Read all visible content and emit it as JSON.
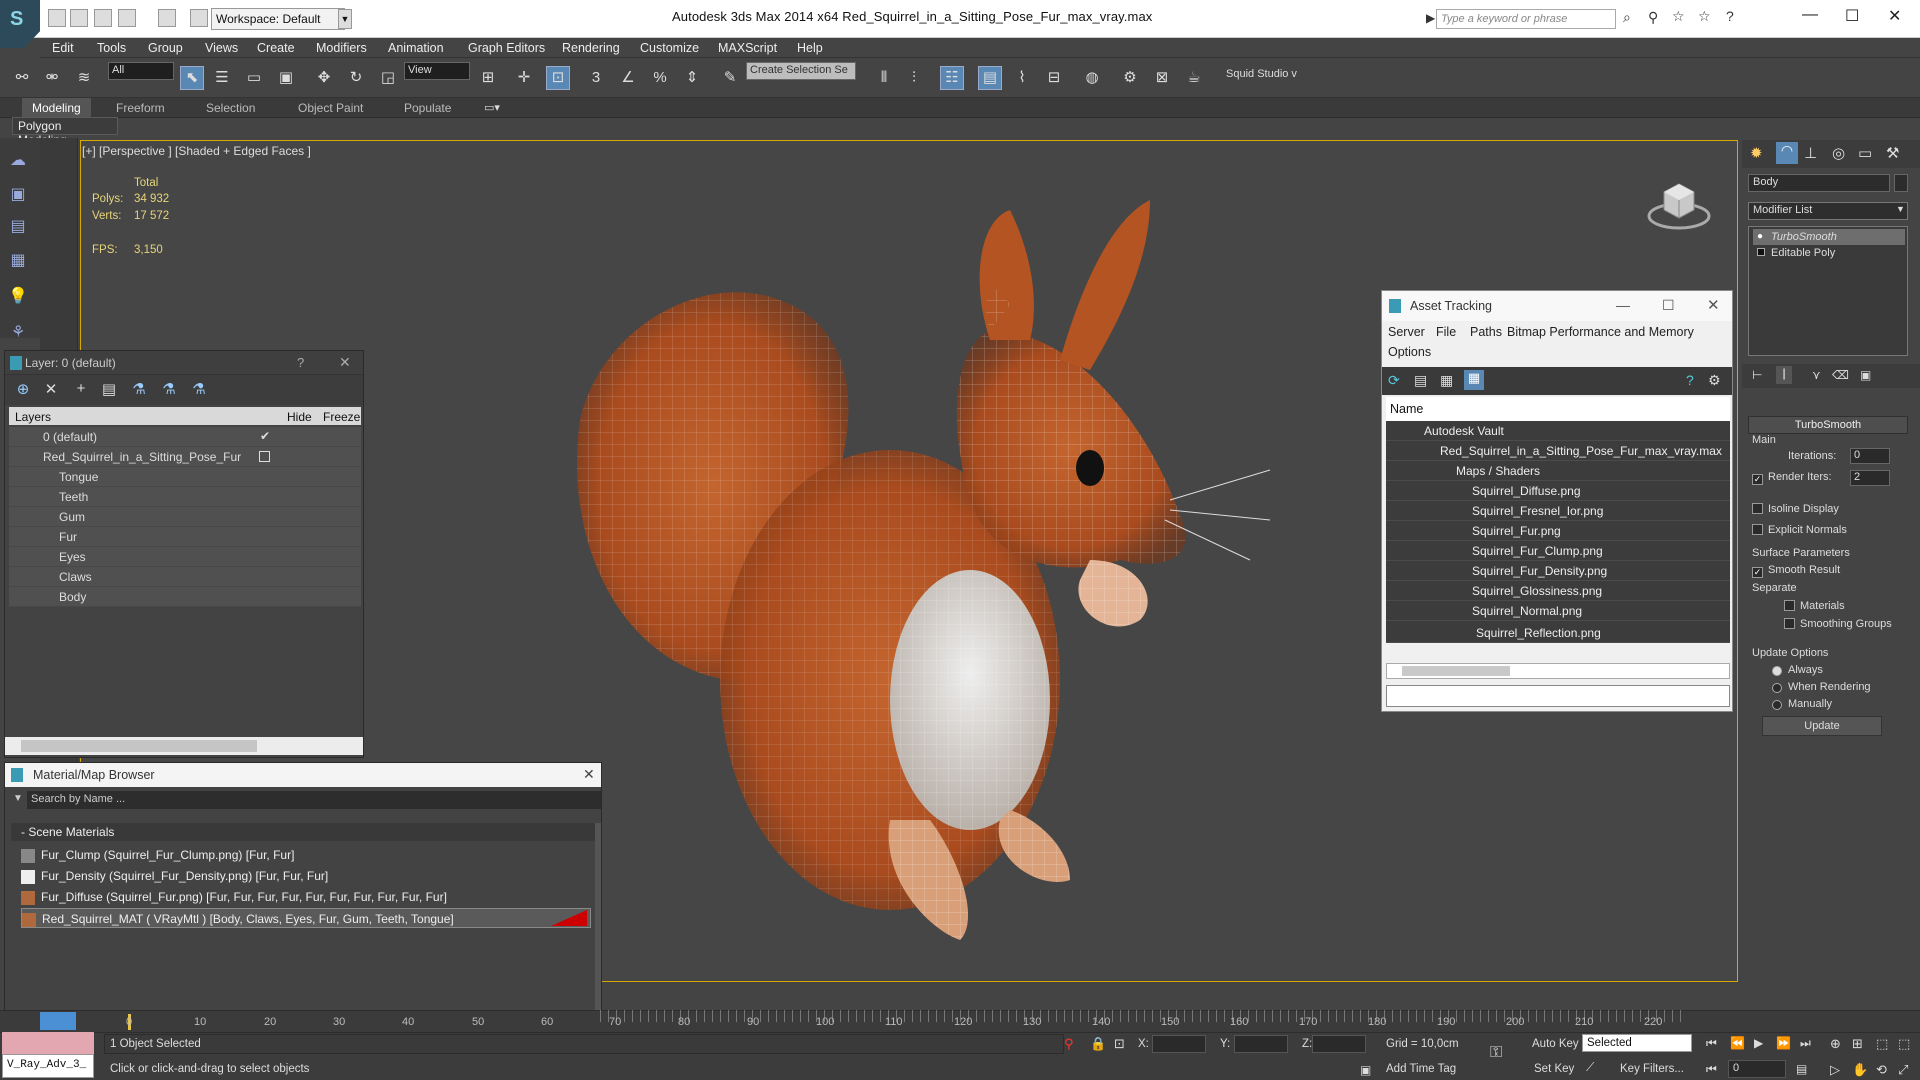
{
  "app": {
    "title": "Autodesk 3ds Max  2014 x64      Red_Squirrel_in_a_Sitting_Pose_Fur_max_vray.max",
    "workspace_label": "Workspace: Default",
    "search_placeholder": "Type a keyword or phrase"
  },
  "menu": [
    "Edit",
    "Tools",
    "Group",
    "Views",
    "Create",
    "Modifiers",
    "Animation",
    "Graph Editors",
    "Rendering",
    "Customize",
    "MAXScript",
    "Help"
  ],
  "toolbar": {
    "filter": "All",
    "coord": "View",
    "selection_set": "Create Selection Se",
    "project": "Squid Studio v"
  },
  "ribbon": {
    "tabs": [
      "Modeling",
      "Freeform",
      "Selection",
      "Object Paint",
      "Populate"
    ],
    "active_tab": "Modeling",
    "sub": "Polygon Modeling"
  },
  "viewport": {
    "label": "[+] [Perspective ] [Shaded + Edged Faces ]",
    "stats_header": "Total",
    "polys_label": "Polys:",
    "polys_value": "34 932",
    "verts_label": "Verts:",
    "verts_value": "17 572",
    "fps_label": "FPS:",
    "fps_value": "3,150"
  },
  "layer_panel": {
    "title": "Layer: 0 (default)",
    "col_layers": "Layers",
    "col_hide": "Hide",
    "col_freeze": "Freeze",
    "rows": [
      "0 (default)",
      "Red_Squirrel_in_a_Sitting_Pose_Fur",
      "Tongue",
      "Teeth",
      "Gum",
      "Fur",
      "Eyes",
      "Claws",
      "Body"
    ]
  },
  "material_browser": {
    "title": "Material/Map Browser",
    "search_placeholder": "Search by Name ...",
    "section": "- Scene Materials",
    "rows": [
      "Fur_Clump (Squirrel_Fur_Clump.png) [Fur, Fur]",
      "Fur_Density (Squirrel_Fur_Density.png) [Fur, Fur, Fur]",
      "Fur_Diffuse (Squirrel_Fur.png) [Fur, Fur, Fur, Fur, Fur, Fur, Fur, Fur, Fur, Fur]",
      "Red_Squirrel_MAT ( VRayMtl ) [Body, Claws, Eyes, Fur, Gum, Teeth, Tongue]"
    ]
  },
  "asset_tracking": {
    "title": "Asset Tracking",
    "menu": [
      "Server",
      "File",
      "Paths",
      "Bitmap Performance and Memory",
      "Options"
    ],
    "col_name": "Name",
    "rows": [
      "Autodesk Vault",
      "Red_Squirrel_in_a_Sitting_Pose_Fur_max_vray.max",
      "Maps / Shaders",
      "Squirrel_Diffuse.png",
      "Squirrel_Fresnel_Ior.png",
      "Squirrel_Fur.png",
      "Squirrel_Fur_Clump.png",
      "Squirrel_Fur_Density.png",
      "Squirrel_Glossiness.png",
      "Squirrel_Normal.png",
      "Squirrel_Reflection.png"
    ]
  },
  "command_panel": {
    "object_name": "Body",
    "modifier_list": "Modifier List",
    "stack": [
      "TurboSmooth",
      "Editable Poly"
    ],
    "rollout": "TurboSmooth",
    "main_label": "Main",
    "iterations_label": "Iterations:",
    "iterations_value": "0",
    "render_iters_label": "Render Iters:",
    "render_iters_value": "2",
    "isoline": "Isoline Display",
    "explicit": "Explicit Normals",
    "surface_params": "Surface Parameters",
    "smooth_result": "Smooth Result",
    "separate": "Separate",
    "materials": "Materials",
    "smoothing_groups": "Smoothing Groups",
    "update_options": "Update Options",
    "always": "Always",
    "when_rendering": "When Rendering",
    "manually": "Manually",
    "update_btn": "Update"
  },
  "timeline": {
    "ticks": [
      "0",
      "10",
      "20",
      "30",
      "40",
      "50",
      "60",
      "70",
      "80",
      "90",
      "100",
      "110",
      "120",
      "130",
      "140",
      "150",
      "160",
      "170",
      "180",
      "190",
      "200",
      "210",
      "220"
    ]
  },
  "status": {
    "selected": "1 Object Selected",
    "prompt": "Click or click-and-drag to select objects",
    "x_label": "X:",
    "y_label": "Y:",
    "z_label": "Z:",
    "grid": "Grid = 10,0cm",
    "add_time_tag": "Add Time Tag",
    "auto_key": "Auto Key",
    "set_key": "Set Key",
    "selected_dd": "Selected",
    "key_filters": "Key Filters...",
    "frame": "0",
    "vray": "V_Ray_Adv_3_"
  }
}
